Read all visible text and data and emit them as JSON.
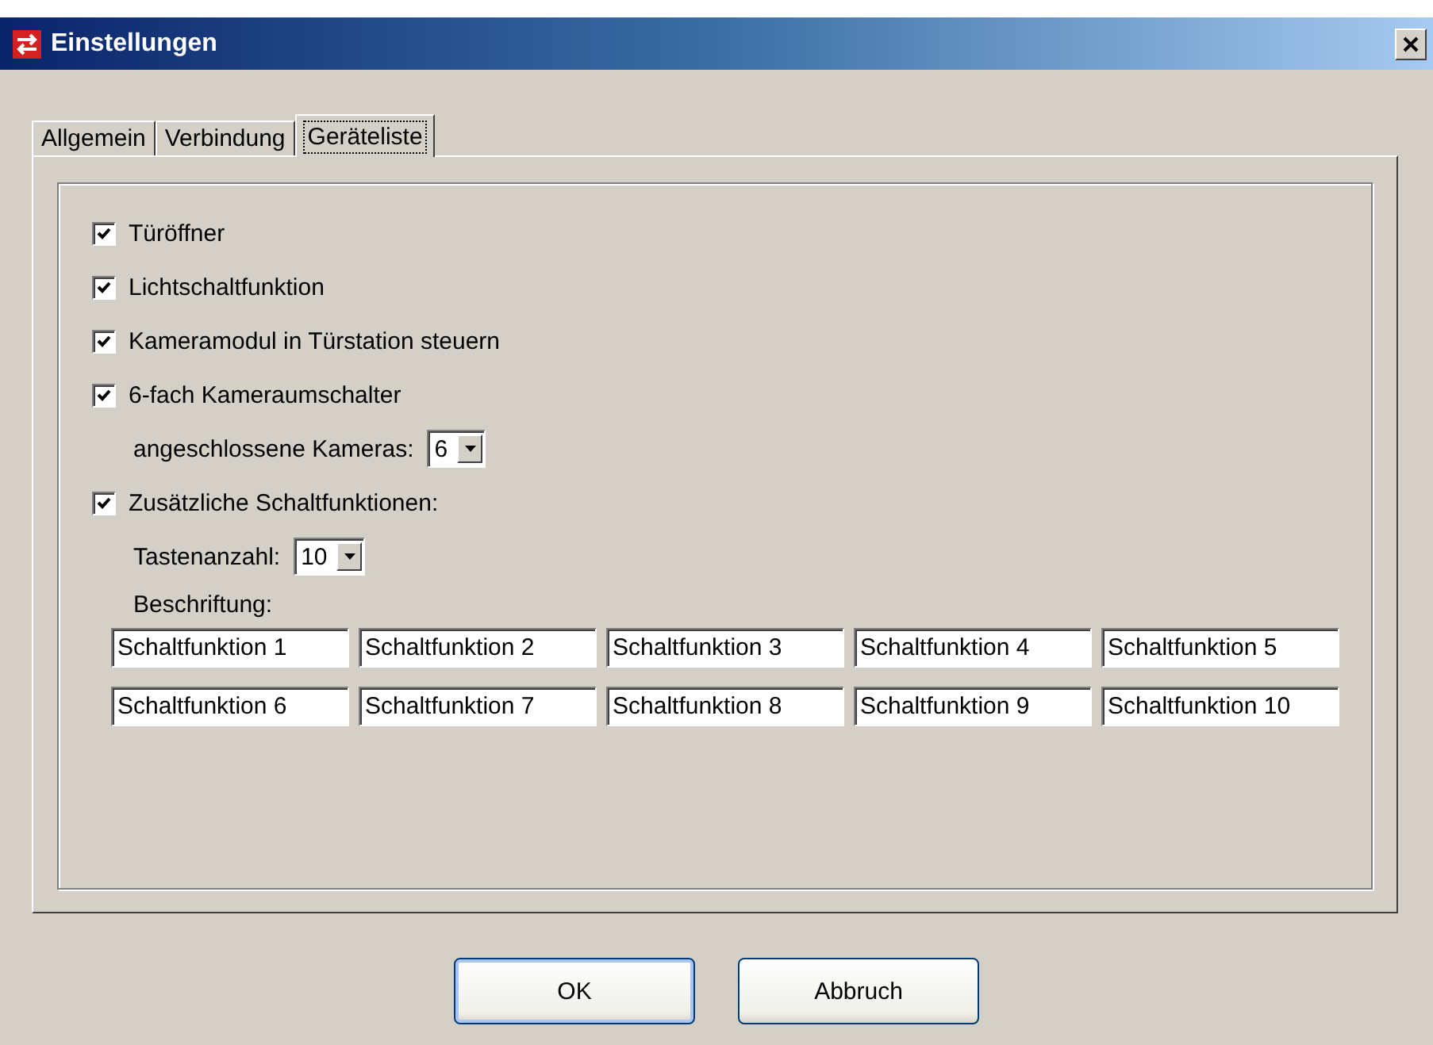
{
  "window": {
    "title": "Einstellungen"
  },
  "tabs": [
    {
      "label": "Allgemein",
      "selected": false
    },
    {
      "label": "Verbindung",
      "selected": false
    },
    {
      "label": "Geräteliste",
      "selected": true
    }
  ],
  "items": [
    {
      "kind": "checkbox",
      "label": "Türöffner",
      "checked": true
    },
    {
      "kind": "checkbox",
      "label": "Lichtschaltfunktion",
      "checked": true
    },
    {
      "kind": "checkbox",
      "label": "Kameramodul in Türstation steuern",
      "checked": true
    },
    {
      "kind": "checkbox",
      "label": "6-fach Kameraumschalter",
      "checked": true
    },
    {
      "kind": "select",
      "label": "angeschlossene Kameras:",
      "value": "6"
    },
    {
      "kind": "checkbox",
      "label": "Zusätzliche Schaltfunktionen:",
      "checked": true
    },
    {
      "kind": "select",
      "label": "Tastenanzahl:",
      "value": "10"
    },
    {
      "kind": "label",
      "label": "Beschriftung:"
    },
    {
      "kind": "fields",
      "values": [
        "Schaltfunktion 1",
        "Schaltfunktion 2",
        "Schaltfunktion 3",
        "Schaltfunktion 4",
        "Schaltfunktion 5",
        "Schaltfunktion 6",
        "Schaltfunktion 7",
        "Schaltfunktion 8",
        "Schaltfunktion 9",
        "Schaltfunktion 10"
      ]
    }
  ],
  "buttons": [
    {
      "label": "OK",
      "default": true
    },
    {
      "label": "Abbruch",
      "default": false
    }
  ]
}
